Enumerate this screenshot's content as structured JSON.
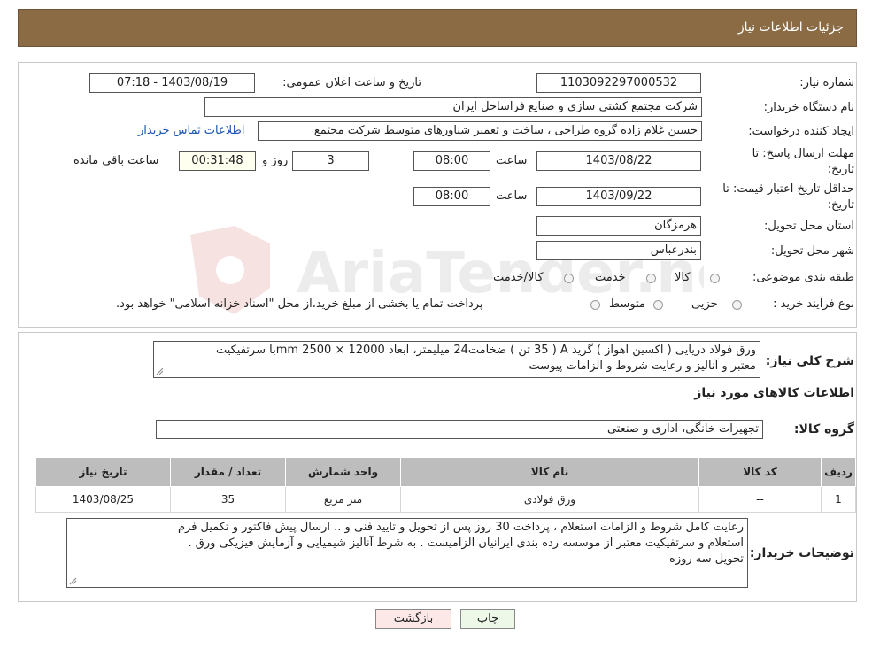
{
  "header": {
    "title": "جزئیات اطلاعات نیاز"
  },
  "form": {
    "need_number_label": "شماره نیاز:",
    "need_number": "1103092297000532",
    "announce_label": "تاریخ و ساعت اعلان عمومی:",
    "announce_value": "1403/08/19 - 07:18",
    "buyer_org_label": "نام دستگاه خریدار:",
    "buyer_org": "شرکت مجتمع کشتی سازی و صنایع فراساحل ایران",
    "requester_label": "ایجاد کننده درخواست:",
    "requester": "حسین  غلام زاده گروه طراحی ، ساخت و تعمیر شناورهای متوسط شرکت مجتمع",
    "contact_link": "اطلاعات تماس خریدار",
    "deadline_label_1": "مهلت ارسال پاسخ: تا",
    "deadline_label_2": "تاریخ:",
    "deadline_date": "1403/08/22",
    "time_label": "ساعت",
    "deadline_time": "08:00",
    "days_value": "3",
    "days_label": "روز و",
    "remaining_time": "00:31:48",
    "remaining_label": "ساعت باقی مانده",
    "validity_label_1": "حداقل تاریخ اعتبار قیمت: تا",
    "validity_label_2": "تاریخ:",
    "validity_date": "1403/09/22",
    "validity_time": "08:00",
    "province_label": "استان محل تحویل:",
    "province": "هرمزگان",
    "city_label": "شهر محل تحویل:",
    "city": "بندرعباس",
    "category_label": "طبقه بندی موضوعی:",
    "category_options": [
      "کالا",
      "خدمت",
      "کالا/خدمت"
    ],
    "purchase_type_label": "نوع فرآیند خرید :",
    "purchase_options": [
      "جزیی",
      "متوسط"
    ],
    "purchase_note": "پرداخت تمام یا بخشی از مبلغ خرید،از محل \"اسناد خزانه اسلامی\" خواهد بود."
  },
  "summary": {
    "label": "شرح کلی نیاز:",
    "line1": "ورق فولاد دریایی ( اکسین اهواز )  گرید A ( 35 تن ) ضخامت24 میلیمتر، ابعاد 12000 × 2500 mmبا سرتفیکیت",
    "line2": "معتبر و آنالیز و رعایت شروط و الزامات پیوست"
  },
  "goods": {
    "section_title": "اطلاعات کالاهای مورد نیاز",
    "group_label": "گروه کالا:",
    "group_value": "تجهیزات خانگی، اداری و صنعتی"
  },
  "table": {
    "headers": [
      "ردیف",
      "کد کالا",
      "نام کالا",
      "واحد شمارش",
      "تعداد / مقدار",
      "تاریخ نیاز"
    ],
    "rows": [
      [
        "1",
        "--",
        "ورق فولادی",
        "متر مربع",
        "35",
        "1403/08/25"
      ]
    ]
  },
  "buyer_notes": {
    "label": "توضیحات خریدار:",
    "line1": "رعایت کامل شروط و الزامات استعلام  ،  پرداخت 30 روز  پس از تحویل و تایید فنی و ..  ارسال  پیش فاکتور و تکمیل فرم",
    "line2": "استعلام و سرتفیکیت معتبر از موسسه رده بندی ایرانیان  الزامیست . به شرط  آنالیز شیمیایی و آزمایش فیزیکی ورق .",
    "line3": "تحویل سه روزه"
  },
  "buttons": {
    "print": "چاپ",
    "back": "بازگشت"
  },
  "watermark_text": "AriaTender.neT",
  "colors": {
    "header_bg": "#8b6b44",
    "link": "#1a56b0",
    "back_btn_bg": "#fde8e8",
    "print_btn_bg": "#eef8e8"
  }
}
